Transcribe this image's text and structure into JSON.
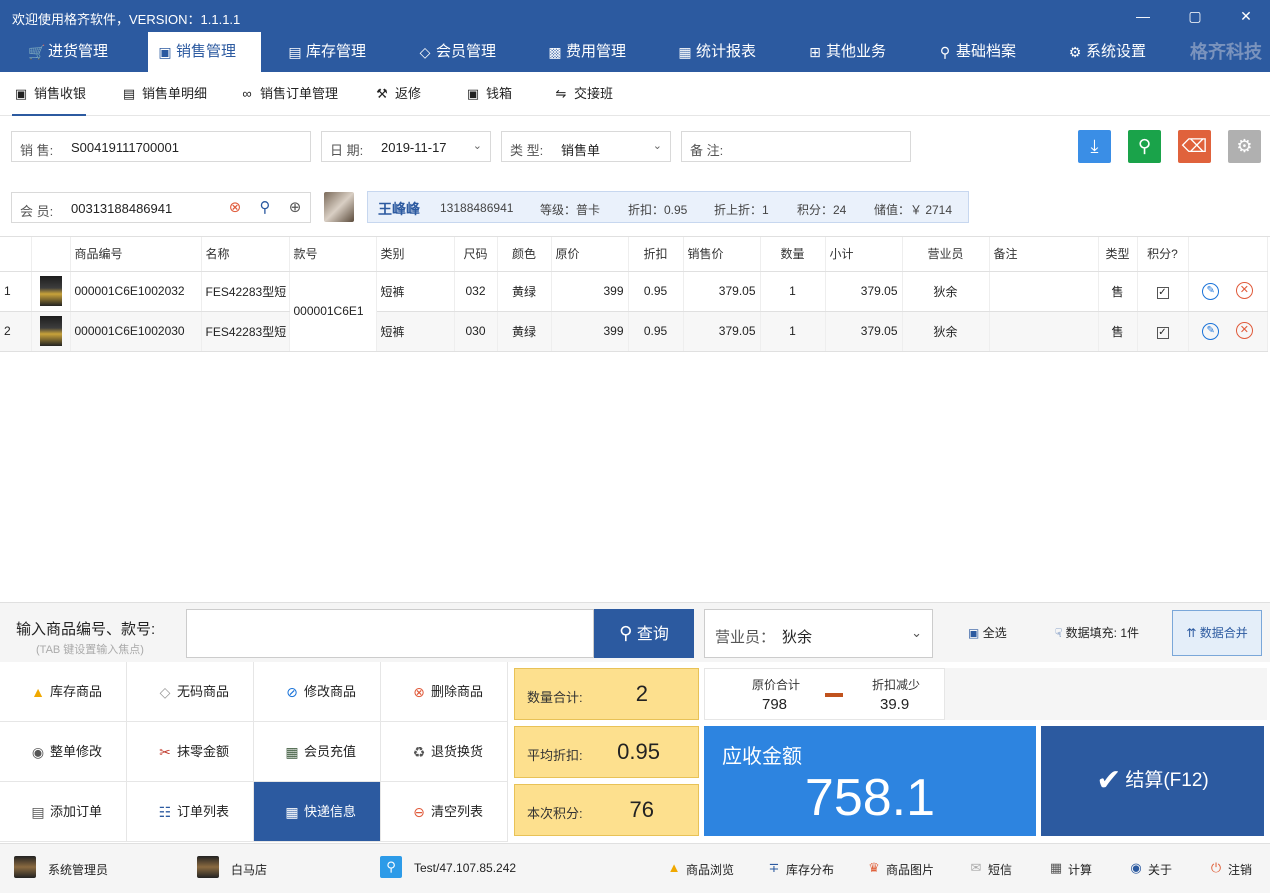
{
  "window": {
    "title": "欢迎使用格齐软件，VERSION：1.1.1.1"
  },
  "brand": "格齐科技",
  "main_nav": [
    {
      "label": "进货管理",
      "icon": "cart-icon"
    },
    {
      "label": "销售管理",
      "icon": "bag-icon",
      "active": true
    },
    {
      "label": "库存管理",
      "icon": "warehouse-icon"
    },
    {
      "label": "会员管理",
      "icon": "diamond-icon"
    },
    {
      "label": "费用管理",
      "icon": "money-icon"
    },
    {
      "label": "统计报表",
      "icon": "chart-icon"
    },
    {
      "label": "其他业务",
      "icon": "grid-icon"
    },
    {
      "label": "基础档案",
      "icon": "pin-icon"
    },
    {
      "label": "系统设置",
      "icon": "gear-icon"
    }
  ],
  "sub_nav": [
    {
      "label": "销售收银",
      "icon": "bag-icon",
      "active": true
    },
    {
      "label": "销售单明细",
      "icon": "list-icon"
    },
    {
      "label": "销售订单管理",
      "icon": "clip-icon"
    },
    {
      "label": "返修",
      "icon": "wrench-icon"
    },
    {
      "label": "钱箱",
      "icon": "safe-icon"
    },
    {
      "label": "交接班",
      "icon": "swap-icon"
    }
  ],
  "form": {
    "sale_label": "销  售:",
    "sale_value": "S00419111700001",
    "date_label": "日  期:",
    "date_value": "2019-11-17",
    "type_label": "类  型:",
    "type_value": "销售单",
    "note_label": "备  注:",
    "note_value": "",
    "member_label": "会  员:",
    "member_value": "00313188486941"
  },
  "member_info": {
    "name": "王峰峰",
    "phone": "13188486941",
    "level": "等级：普卡",
    "discount": "折扣：0.95",
    "discount_on": "折上折：1",
    "points": "积分：24",
    "balance": "储值：￥ 2714"
  },
  "table": {
    "headers": [
      "",
      "",
      "商品编号",
      "名称",
      "款号",
      "类别",
      "尺码",
      "颜色",
      "原价",
      "折扣",
      "销售价",
      "数量",
      "小计",
      "营业员",
      "备注",
      "类型",
      "积分?",
      ""
    ],
    "rows": [
      {
        "no": "1",
        "code": "000001C6E1002032",
        "name": "FES42283型短",
        "category": "短裤",
        "size": "032",
        "color": "黄绿",
        "price": "399",
        "discount": "0.95",
        "sale_price": "379.05",
        "qty": "1",
        "subtotal": "379.05",
        "staff": "狄余",
        "note": "",
        "type": "售"
      },
      {
        "no": "2",
        "code": "000001C6E1002030",
        "name": "FES42283型短",
        "category": "短裤",
        "size": "030",
        "color": "黄绿",
        "price": "399",
        "discount": "0.95",
        "sale_price": "379.05",
        "qty": "1",
        "subtotal": "379.05",
        "staff": "狄余",
        "note": "",
        "type": "售"
      }
    ],
    "style_no_merged": "000001C6E1"
  },
  "input_bar": {
    "label": "输入商品编号、款号:",
    "hint": "(TAB 键设置输入焦点)",
    "search_value": "",
    "query_label": "查询",
    "salesman_label": "营业员：",
    "salesman_value": "狄余",
    "select_all": "全选",
    "fill_label": "数据填充:",
    "fill_value": "1件",
    "merge_label": "数据合并"
  },
  "actions": [
    {
      "label": "库存商品",
      "icon": "shirt-icon"
    },
    {
      "label": "无码商品",
      "icon": "tag-icon"
    },
    {
      "label": "修改商品",
      "icon": "edit-icon"
    },
    {
      "label": "删除商品",
      "icon": "delete-icon"
    },
    {
      "label": "整单修改",
      "icon": "coin-icon"
    },
    {
      "label": "抹零金额",
      "icon": "scissors-icon"
    },
    {
      "label": "会员充值",
      "icon": "card-icon"
    },
    {
      "label": "退货换货",
      "icon": "return-icon"
    },
    {
      "label": "添加订单",
      "icon": "order-add-icon"
    },
    {
      "label": "订单列表",
      "icon": "order-list-icon"
    },
    {
      "label": "快递信息",
      "icon": "express-icon",
      "selected": true
    },
    {
      "label": "清空列表",
      "icon": "clear-icon"
    }
  ],
  "summary": {
    "qty_label": "数量合计:",
    "qty_value": "2",
    "avg_label": "平均折扣:",
    "avg_value": "0.95",
    "pts_label": "本次积分:",
    "pts_value": "76",
    "orig_label": "原价合计",
    "orig_value": "798",
    "reduce_label": "折扣减少",
    "reduce_value": "39.9",
    "due_label": "应收金额",
    "due_value": "758.1",
    "pay_label": "结算(F12)"
  },
  "status_bar": {
    "user": "系统管理员",
    "store": "白马店",
    "server": "Test/47.107.85.242",
    "items": [
      {
        "label": "商品浏览",
        "icon": "shirt-icon"
      },
      {
        "label": "库存分布",
        "icon": "share-icon"
      },
      {
        "label": "商品图片",
        "icon": "image-icon"
      },
      {
        "label": "短信",
        "icon": "mail-icon"
      },
      {
        "label": "计算",
        "icon": "calculator-icon"
      },
      {
        "label": "关于",
        "icon": "info-icon"
      },
      {
        "label": "注销",
        "icon": "power-icon"
      }
    ]
  },
  "colors": {
    "primary": "#2c5aa0",
    "accent_blue": "#2d84e0",
    "summary_yellow": "#fde08e",
    "download": "#3a8ee6",
    "search": "#1aa34a",
    "erase": "#e0623c",
    "settings": "#b0b0b0"
  }
}
